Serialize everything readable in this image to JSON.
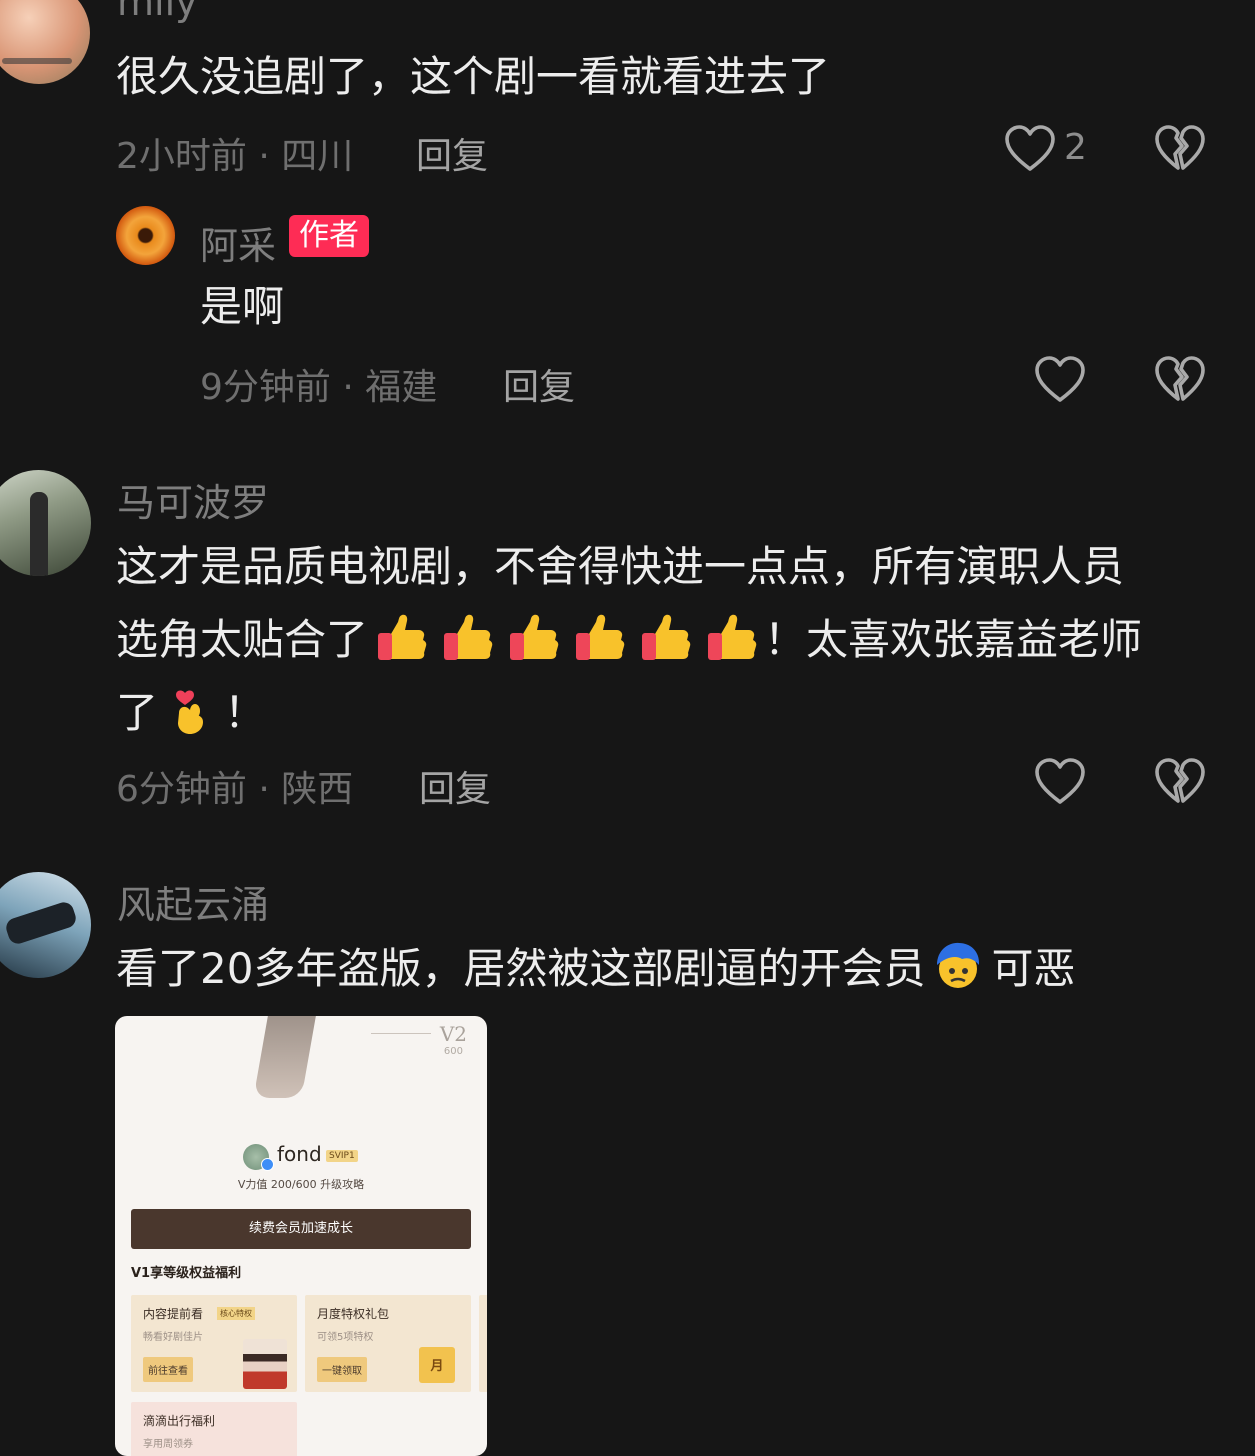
{
  "comments": [
    {
      "username": "mily",
      "text": "很久没追剧了，这个剧一看就看进去了",
      "meta": "2小时前 · 四川",
      "reply_label": "回复",
      "like_count": "2",
      "replies": [
        {
          "username": "阿采",
          "badge": "作者",
          "text": "是啊",
          "meta": "9分钟前 · 福建",
          "reply_label": "回复"
        }
      ]
    },
    {
      "username": "马可波罗",
      "text_line1": "这才是品质电视剧，不舍得快进一点点，所有演职人员",
      "text_line2_a": "选角太贴合了",
      "text_line2_b": "！太喜欢张嘉益老师",
      "text_line3_a": "了",
      "text_line3_b": "！",
      "meta": "6分钟前 · 陕西",
      "reply_label": "回复"
    },
    {
      "username": "风起云涌",
      "text_a": "看了20多年盗版，居然被这部剧逼的开会员",
      "text_b": "可恶",
      "image": {
        "level_top": "V2",
        "level_sub": "600",
        "user": "fond",
        "vip_tag": "SVIP1",
        "v_info": "V力值 200/600 升级攻略",
        "renew_button": "续费会员加速成长",
        "section_title": "V1享等级权益福利",
        "cards": [
          {
            "title": "内容提前看",
            "tag": "核心特权",
            "sub": "畅看好剧佳片",
            "button": "前往查看"
          },
          {
            "title": "月度特权礼包",
            "sub": "可领5项特权",
            "button": "一键领取",
            "gift_label": "月"
          },
          {
            "title": "滴滴出行福利",
            "sub": "享用周领券"
          }
        ]
      }
    }
  ],
  "icons": {
    "like": "heart-outline-icon",
    "dislike": "broken-heart-icon",
    "thumbs": "thumbs-up-emoji",
    "finger_heart": "finger-heart-emoji",
    "blue_face": "blue-hair-face-emoji"
  },
  "colors": {
    "background": "#161616",
    "author_badge": "#fe2c55"
  }
}
